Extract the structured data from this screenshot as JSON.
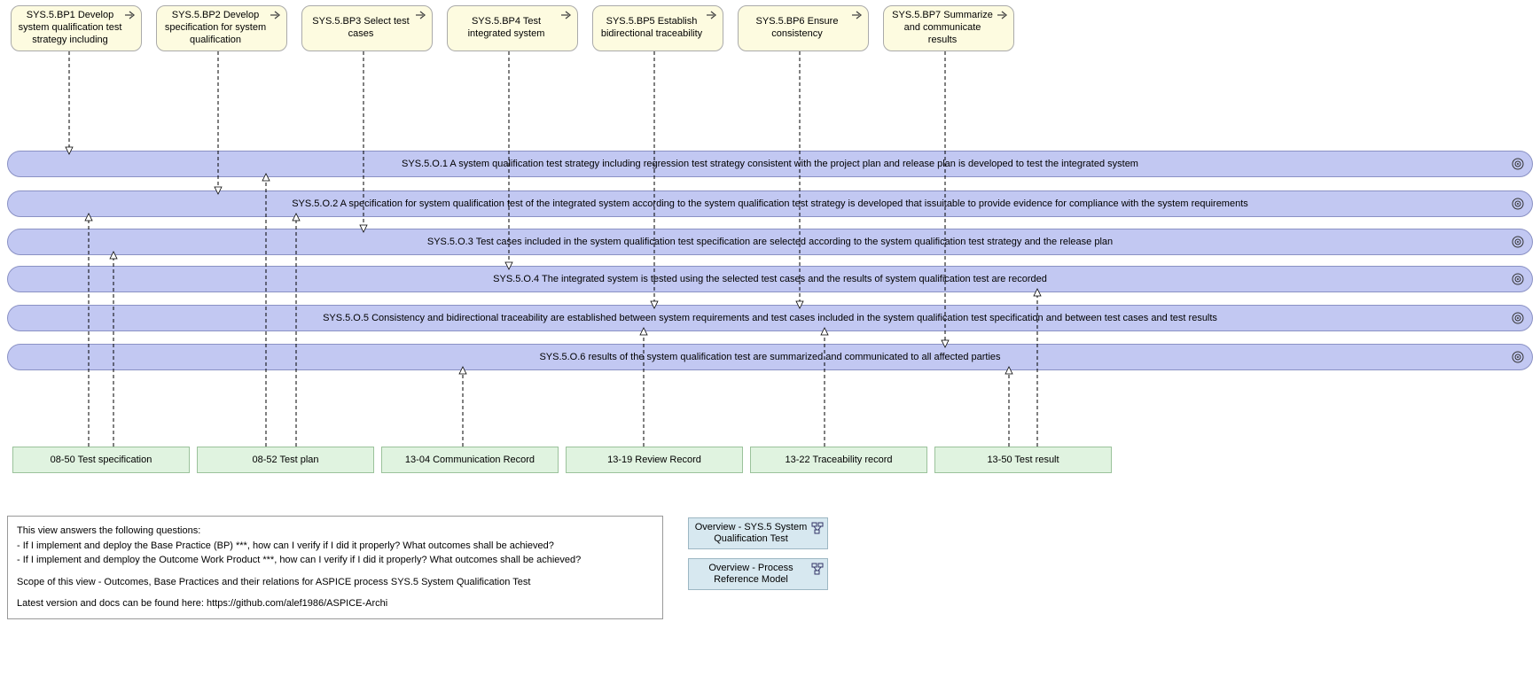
{
  "bp": [
    {
      "id": "bp1",
      "label": "SYS.5.BP1 Develop system qualification test strategy including"
    },
    {
      "id": "bp2",
      "label": "SYS.5.BP2 Develop specification for system qualification"
    },
    {
      "id": "bp3",
      "label": "SYS.5.BP3 Select test cases"
    },
    {
      "id": "bp4",
      "label": "SYS.5.BP4 Test integrated system"
    },
    {
      "id": "bp5",
      "label": "SYS.5.BP5 Establish bidirectional traceability"
    },
    {
      "id": "bp6",
      "label": "SYS.5.BP6 Ensure consistency"
    },
    {
      "id": "bp7",
      "label": "SYS.5.BP7 Summarize and communicate results"
    }
  ],
  "outcomes": [
    {
      "id": "o1",
      "label": "SYS.5.O.1 A system qualification test strategy including regression test strategy consistent with the project plan and release plan is developed to test the integrated system"
    },
    {
      "id": "o2",
      "label": "SYS.5.O.2 A specification for system qualification test of the integrated system according to the system qualification test strategy is developed that issuitable to provide evidence for compliance with the system requirements"
    },
    {
      "id": "o3",
      "label": "SYS.5.O.3 Test cases included in the system qualification test specification are selected according to the system qualification test strategy and the release plan"
    },
    {
      "id": "o4",
      "label": "SYS.5.O.4 The integrated system is tested using the selected test cases and the results of system qualification test are recorded"
    },
    {
      "id": "o5",
      "label": "SYS.5.O.5 Consistency and bidirectional traceability are established between system requirements and test cases included in the system qualification test specification and between test cases and test results"
    },
    {
      "id": "o6",
      "label": "SYS.5.O.6 results of the system qualification test are summarized and communicated to all affected parties"
    }
  ],
  "wps": [
    {
      "id": "wp1",
      "label": "08-50 Test specification"
    },
    {
      "id": "wp2",
      "label": "08-52 Test plan"
    },
    {
      "id": "wp3",
      "label": "13-04 Communication Record"
    },
    {
      "id": "wp4",
      "label": "13-19 Review Record"
    },
    {
      "id": "wp5",
      "label": "13-22 Traceability record"
    },
    {
      "id": "wp6",
      "label": "13-50 Test result"
    }
  ],
  "note": {
    "line1": "This view answers the following questions:",
    "line2": "- If I implement and deploy the Base Practice (BP) ***, how can I verify if I did it properly? What outcomes shall be achieved?",
    "line3": "- If I implement and demploy the Outcome Work Product ***, how can I verify if I did it properly? What outcomes shall be achieved?",
    "line4": "Scope of this view - Outcomes, Base Practices and their relations for ASPICE process SYS.5 System Qualification Test",
    "line5": "Latest version and docs can be found here: https://github.com/alef1986/ASPICE-Archi"
  },
  "nav": [
    {
      "id": "nav1",
      "label": "Overview - SYS.5 System Qualification Test"
    },
    {
      "id": "nav2",
      "label": "Overview - Process Reference Model"
    }
  ]
}
